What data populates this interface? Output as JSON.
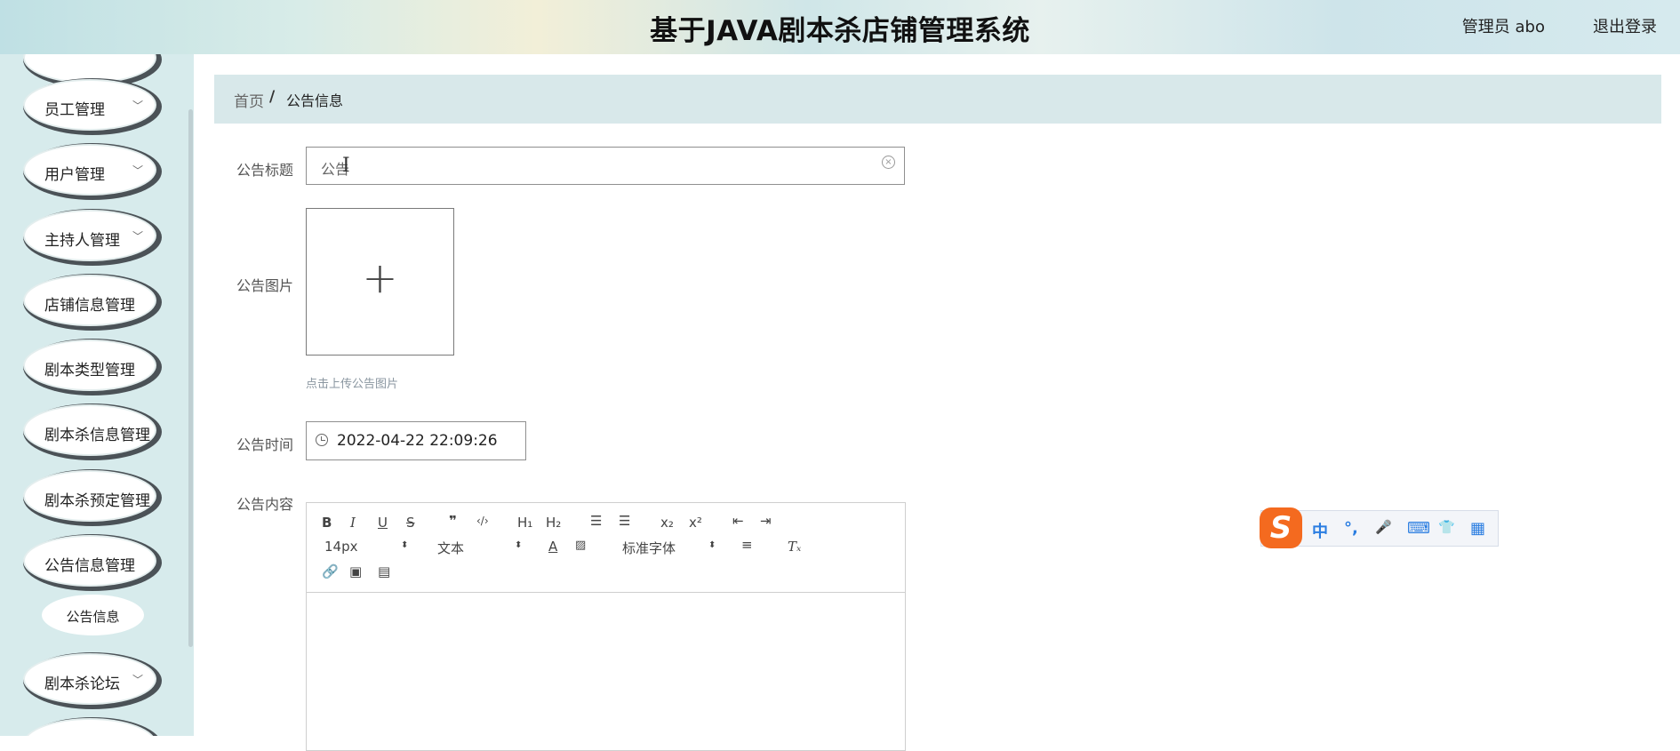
{
  "header": {
    "title": "基于JAVA剧本杀店铺管理系统",
    "user": "管理员 abo",
    "logout": "退出登录"
  },
  "sidebar": {
    "items": [
      {
        "label": "员工管理"
      },
      {
        "label": "用户管理"
      },
      {
        "label": "主持人管理"
      },
      {
        "label": "店铺信息管理"
      },
      {
        "label": "剧本类型管理"
      },
      {
        "label": "剧本杀信息管理"
      },
      {
        "label": "剧本杀预定管理"
      },
      {
        "label": "公告信息管理"
      },
      {
        "label": "剧本杀论坛"
      }
    ],
    "sub_item": "公告信息",
    "chevron": "chevron-down-icon"
  },
  "breadcrumb": {
    "home": "首页",
    "separator": "/",
    "current": "公告信息"
  },
  "form": {
    "title_label": "公告标题",
    "title_value": "公告",
    "image_label": "公告图片",
    "image_hint": "点击上传公告图片",
    "time_label": "公告时间",
    "time_value": "2022-04-22 22:09:26",
    "content_label": "公告内容"
  },
  "editor": {
    "font_size": "14px",
    "header_select": "文本",
    "font_family": "标准字体"
  },
  "ime": {
    "items": [
      "中",
      "°,",
      "🎤",
      "⌨",
      "👕",
      "▦"
    ]
  }
}
